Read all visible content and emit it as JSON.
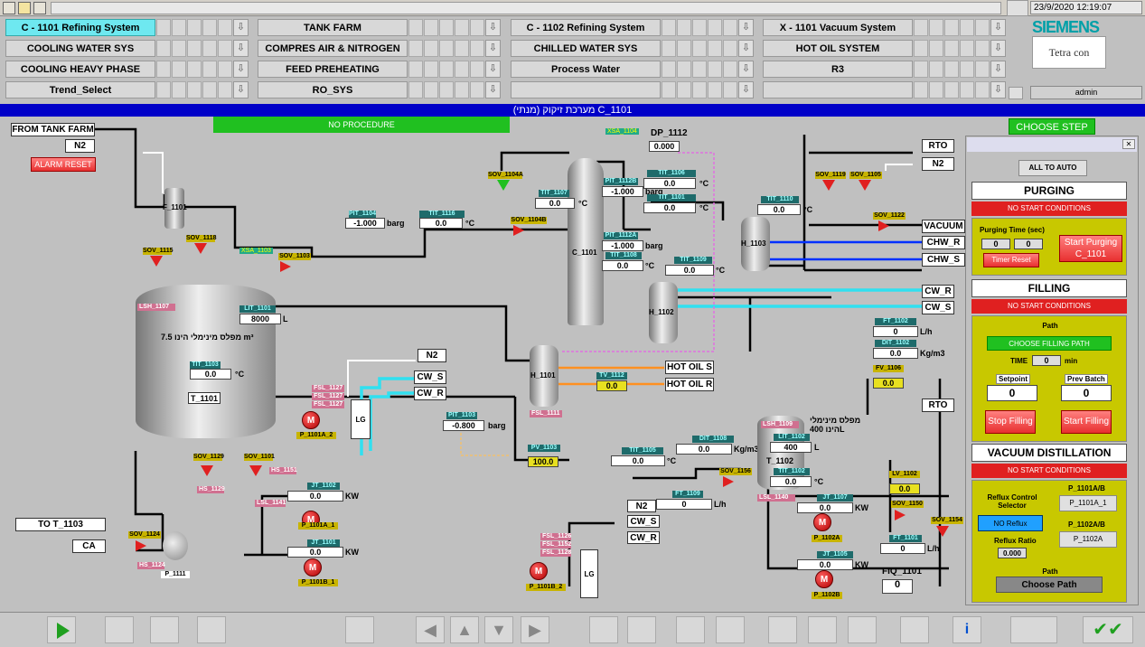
{
  "header": {
    "datetime": "23/9/2020 12:19:07",
    "user": "admin",
    "brand": "SIEMENS",
    "logo_text": "Tetra con"
  },
  "nav": {
    "row1": [
      "C - 1101 Refining System",
      "TANK FARM",
      "C - 1102 Refining System",
      "X - 1101 Vacuum System"
    ],
    "row2": [
      "COOLING WATER SYS",
      "COMPRES AIR & NITROGEN",
      "CHILLED WATER SYS",
      "HOT OIL SYSTEM"
    ],
    "row3": [
      "COOLING HEAVY PHASE",
      "FEED PREHEATING",
      "Process Water",
      "R3"
    ],
    "row4": [
      "Trend_Select",
      "RO_SYS",
      "",
      ""
    ]
  },
  "title": "מערכת זיקוק (מנתי) C_1101",
  "procedure": "NO PROCEDURE",
  "choose_step": "CHOOSE STEP",
  "labels": {
    "from_tank_farm": "FROM TANK FARM",
    "n2": "N2",
    "alarm_reset": "ALARM RESET",
    "rto": "RTO",
    "vacuum": "VACUUM",
    "chw_r": "CHW_R",
    "chw_s": "CHW_S",
    "cw_r": "CW_R",
    "cw_s": "CW_S",
    "hot_oil_s": "HOT OIL S",
    "hot_oil_r": "HOT OIL R",
    "to_t1103": "TO T_1103",
    "ca": "CA",
    "t1101": "T_1101",
    "t1102": "T_1102",
    "tank_note": "מפלס מינימלי הינו 7.5 m³",
    "tank2_note": "מפלס מינימלי הינו 400L",
    "fiq": "FIQ_1101",
    "fiq_val": "0",
    "dp": "DP_1112",
    "dp_val": "0.000",
    "lg": "LG"
  },
  "instruments": {
    "pit1104": {
      "tag": "PIT_1104",
      "val": "-1.000",
      "unit": "barg"
    },
    "tit1116": {
      "tag": "TIT_1116",
      "val": "0.0",
      "unit": "°C"
    },
    "tit1107": {
      "tag": "TIT_1107",
      "val": "0.0",
      "unit": "°C"
    },
    "pit1112b": {
      "tag": "PIT_1112B",
      "val": "-1.000",
      "unit": "barg"
    },
    "tit1106": {
      "tag": "TIT_1106",
      "val": "0.0",
      "unit": "°C"
    },
    "tit1101": {
      "tag": "TIT_1101",
      "val": "0.0",
      "unit": "°C"
    },
    "tit1110": {
      "tag": "TIT_1110",
      "val": "0.0",
      "unit": "°C"
    },
    "pit1112a": {
      "tag": "PIT_1112A",
      "val": "-1.000",
      "unit": "barg"
    },
    "tit1108": {
      "tag": "TIT_1108",
      "val": "0.0",
      "unit": "°C"
    },
    "tit1109": {
      "tag": "TIT_1109",
      "val": "0.0",
      "unit": "°C"
    },
    "lit1101": {
      "tag": "LIT_1101",
      "val": "8000",
      "unit": "L"
    },
    "tit1103": {
      "tag": "TIT_1103",
      "val": "0.0",
      "unit": "°C"
    },
    "pit1103": {
      "tag": "PIT_1103",
      "val": "-0.800",
      "unit": "barg"
    },
    "tit1105": {
      "tag": "TIT_1105",
      "val": "0.0",
      "unit": "°C"
    },
    "dit1108": {
      "tag": "DIT_1108",
      "val": "0.0",
      "unit": "Kg/m3"
    },
    "ft1109": {
      "tag": "FT_1109",
      "val": "0",
      "unit": "L/h"
    },
    "ft1102": {
      "tag": "FT_1102",
      "val": "0",
      "unit": "L/h"
    },
    "dit1102": {
      "tag": "DIT_1102",
      "val": "0.0",
      "unit": "Kg/m3"
    },
    "lit1102": {
      "tag": "LIT_1102",
      "val": "400",
      "unit": "L"
    },
    "tit1102": {
      "tag": "TIT_1102",
      "val": "0.0",
      "unit": "°C"
    },
    "jt1102": {
      "tag": "JT_1102",
      "val": "0.0",
      "unit": "KW"
    },
    "jt1101": {
      "tag": "JT_1101",
      "val": "0.0",
      "unit": "KW"
    },
    "jt1107": {
      "tag": "JT_1107",
      "val": "0.0",
      "unit": "KW"
    },
    "jt1105": {
      "tag": "JT_1105",
      "val": "0.0",
      "unit": "KW"
    },
    "ft1101": {
      "tag": "FT_1101",
      "val": "0",
      "unit": "L/h"
    },
    "pv1103": {
      "tag": "PV_1103",
      "val": "100.0"
    },
    "fv1106": {
      "tag": "FV_1106",
      "val": "0.0"
    },
    "lv1102": {
      "tag": "LV_1102",
      "val": "0.0"
    },
    "tv1112": {
      "tag": "TV_1112",
      "val": "0.0"
    }
  },
  "equipment": {
    "f1101": "F_1101",
    "h1101": "H_1101",
    "h1102": "H_1102",
    "h1103": "H_1103",
    "c1101": "C_1101",
    "p1111": "P_1111",
    "p1101a2": "P_1101A_2",
    "p1101a1": "P_1101A_1",
    "p1101b1": "P_1101B_1",
    "p1101b2": "P_1101B_2",
    "p1102a": "P_1102A",
    "p1102b": "P_1102B",
    "xsa1104": "XSA_1104",
    "xsa1103": "XSA_1103",
    "sov1115": "SOV_1115",
    "sov1118": "SOV_1118",
    "sov1103": "SOV_1103",
    "sov1104a": "SOV_1104A",
    "sov1104b": "SOV_1104B",
    "sov1119": "SOV_1119",
    "sov1105": "SOV_1105",
    "sov1122": "SOV_1122",
    "sov1129": "SOV_1129",
    "sov1101": "SOV_1101",
    "sov1124": "SOV_1124",
    "sov1156": "SOV_1156",
    "sov1150": "SOV_1150",
    "sov1154": "SOV_1154",
    "lsh1107": "LSH_1107",
    "lsh1109": "LSH_1109",
    "fsl1127a": "FSL_1127",
    "fsl1127b": "FSL_1127",
    "fsl1127c": "FSL_1127",
    "fsl1126": "FSL_1126",
    "fsl1152": "FSL_1152",
    "fsl1128": "FSL_1128",
    "fsl1111": "FSL_1111",
    "lsl1141": "LSL_1141",
    "lsl1140": "LSL_1140",
    "hs1129": "HS_1129",
    "hs1151": "HS_1151",
    "hs1124": "HS_1124"
  },
  "panel": {
    "all_to_auto": "ALL TO AUTO",
    "purging": "PURGING",
    "no_start": "NO START CONDITIONS",
    "purging_time": "Purging Time (sec)",
    "pt1": "0",
    "pt2": "0",
    "timer_reset": "Timer Reset",
    "start_purging": "Start Purging C_1101",
    "filling": "FILLING",
    "path": "Path",
    "choose_filling_path": "CHOOSE FILLING PATH",
    "time_label": "TIME",
    "time_val": "0",
    "time_unit": "min",
    "setpoint": "Setpoint",
    "setpoint_val": "0",
    "prev_batch": "Prev Batch",
    "prev_batch_val": "0",
    "stop_filling": "Stop Filling",
    "start_filling": "Start Filling",
    "vacuum_dist": "VACUUM DISTILLATION",
    "reflux_sel": "Reflux Control Selector",
    "no_reflux": "NO Reflux",
    "p1101ab": "P_1101A/B",
    "p1101a1": "P_1101A_1",
    "p1102ab": "P_1102A/B",
    "p1102a": "P_1102A",
    "reflux_ratio": "Reflux Ratio",
    "reflux_val": "0.000",
    "path2": "Path",
    "choose_path": "Choose Path"
  },
  "colors": {
    "accent": "#0000c8",
    "active_tab": "#6ee8f0",
    "green": "#20c020",
    "red": "#e02020",
    "yellow": "#c8c800"
  }
}
